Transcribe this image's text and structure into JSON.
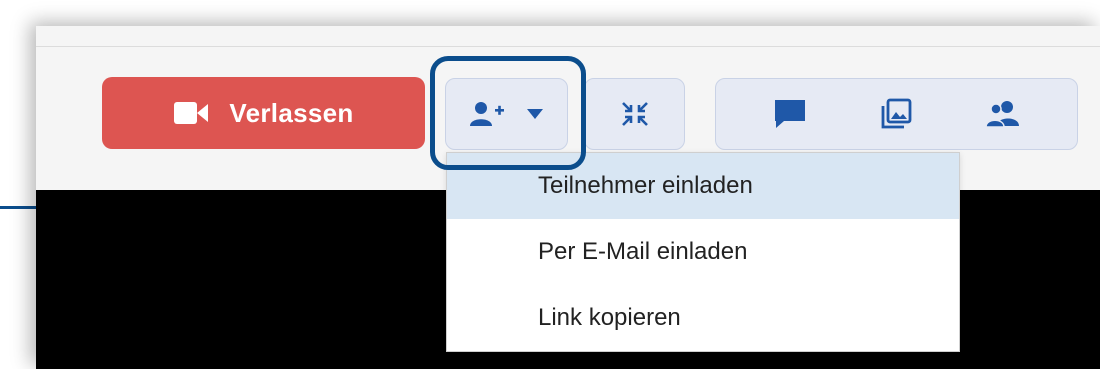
{
  "toolbar": {
    "leave_label": "Verlassen",
    "leave_icon": "video-camera-icon",
    "invite_icon": "add-person-icon",
    "invite_caret_icon": "caret-down-icon",
    "compact_icon": "shrink-arrows-icon",
    "chat_icon": "chat-bubble-icon",
    "media_icon": "image-gallery-icon",
    "participants_icon": "participants-icon"
  },
  "invite_menu": {
    "items": [
      {
        "label": "Teilnehmer einladen",
        "active": true
      },
      {
        "label": "Per E-Mail einladen",
        "active": false
      },
      {
        "label": "Link kopieren",
        "active": false
      }
    ]
  },
  "colors": {
    "leave_button": "#dd5551",
    "icon_blue": "#1f58a8",
    "highlight": "#0b4d8c",
    "menu_active": "#d8e6f3"
  }
}
